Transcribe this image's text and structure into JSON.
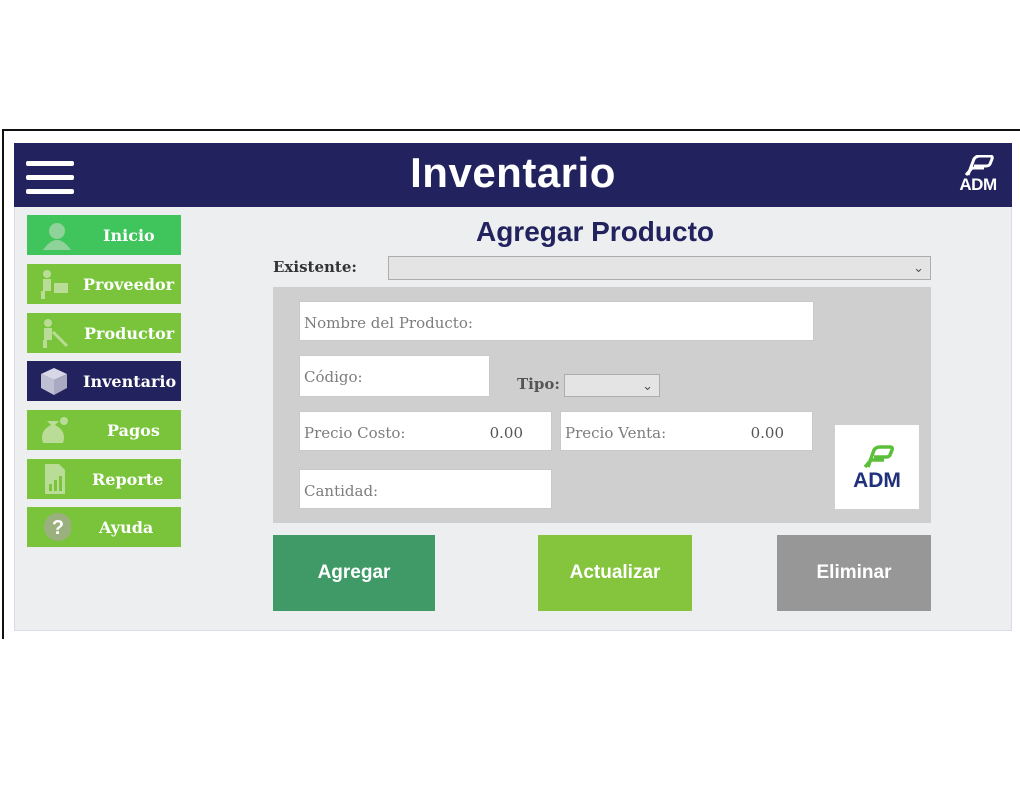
{
  "header": {
    "title": "Inventario",
    "logo_text": "ADM"
  },
  "nav": {
    "items": [
      {
        "label": "Inicio",
        "icon": "home-person-icon",
        "color": "#3fc55b"
      },
      {
        "label": "Proveedor",
        "icon": "supplier-icon",
        "color": "#79c43a"
      },
      {
        "label": "Productor",
        "icon": "farmer-icon",
        "color": "#79c43a"
      },
      {
        "label": "Inventario",
        "icon": "box-icon",
        "color": "#22225e"
      },
      {
        "label": "Pagos",
        "icon": "money-bag-icon",
        "color": "#79c43a"
      },
      {
        "label": "Reporte",
        "icon": "report-icon",
        "color": "#79c43a"
      },
      {
        "label": "Ayuda",
        "icon": "help-icon",
        "color": "#79c43a"
      }
    ]
  },
  "form": {
    "title": "Agregar Producto",
    "existente_label": "Existente:",
    "existente_value": "",
    "nombre_placeholder": "Nombre del Producto:",
    "codigo_placeholder": "Código:",
    "tipo_label": "Tipo:",
    "tipo_value": "",
    "precio_costo_label": "Precio Costo:",
    "precio_costo_value": "0.00",
    "precio_venta_label": "Precio Venta:",
    "precio_venta_value": "0.00",
    "cantidad_placeholder": "Cantidad:",
    "logo_text": "ADM"
  },
  "actions": {
    "agregar": "Agregar",
    "actualizar": "Actualizar",
    "eliminar": "Eliminar"
  },
  "colors": {
    "header": "#22225e",
    "panel": "#cfcfcf",
    "agregar": "#3f9a68",
    "actualizar": "#84c53d",
    "eliminar": "#979797"
  }
}
